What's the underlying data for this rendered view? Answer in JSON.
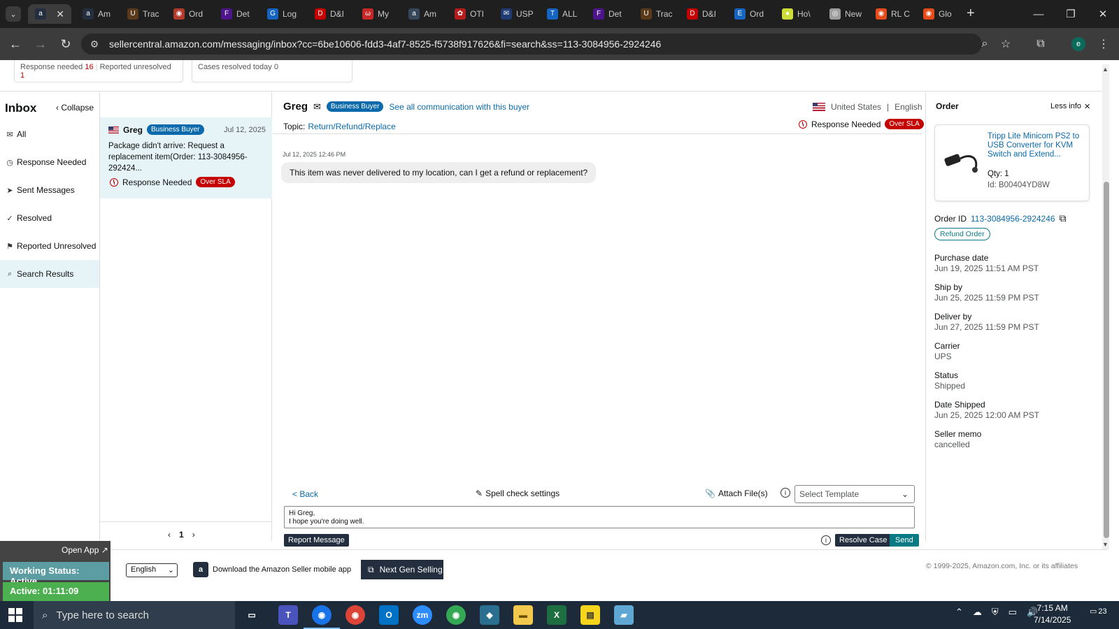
{
  "browser": {
    "tabs": [
      {
        "label": "",
        "color": "#232f3e",
        "glyph": "a"
      },
      {
        "label": "Am",
        "color": "#232f3e",
        "glyph": "a"
      },
      {
        "label": "Trac",
        "color": "#5a3a1a",
        "glyph": "U"
      },
      {
        "label": "Ord",
        "color": "#b03a2e",
        "glyph": "◉"
      },
      {
        "label": "Det",
        "color": "#4d148c",
        "glyph": "F"
      },
      {
        "label": "Log",
        "color": "#1565c0",
        "glyph": "G"
      },
      {
        "label": "D&I",
        "color": "#c40000",
        "glyph": "D"
      },
      {
        "label": "My",
        "color": "#c62828",
        "glyph": "ω"
      },
      {
        "label": "Am",
        "color": "#37475a",
        "glyph": "a"
      },
      {
        "label": "OTI",
        "color": "#b71c1c",
        "glyph": "✿"
      },
      {
        "label": "USP",
        "color": "#1f3b73",
        "glyph": "✉"
      },
      {
        "label": "ALL",
        "color": "#1565c0",
        "glyph": "T"
      },
      {
        "label": "Det",
        "color": "#4d148c",
        "glyph": "F"
      },
      {
        "label": "Trac",
        "color": "#5a3a1a",
        "glyph": "U"
      },
      {
        "label": "D&I",
        "color": "#c40000",
        "glyph": "D"
      },
      {
        "label": "Ord",
        "color": "#1565c0",
        "glyph": "E"
      },
      {
        "label": "Ho\\",
        "color": "#cddc39",
        "glyph": "●"
      },
      {
        "label": "New",
        "color": "#9e9e9e",
        "glyph": "◎"
      },
      {
        "label": "RL C",
        "color": "#e64a19",
        "glyph": "◉"
      },
      {
        "label": "Glo",
        "color": "#e64a19",
        "glyph": "◉"
      }
    ],
    "new_tab": "+",
    "url": "sellercentral.amazon.com/messaging/inbox?cc=6be10606-fdd3-4af7-8525-f5738f917626&fi=search&ss=113-3084956-2924246",
    "profile_initial": "e"
  },
  "stats": {
    "response_needed_label": "Response needed",
    "response_needed_count": "16",
    "reported_unresolved_label": "Reported unresolved",
    "reported_unresolved_count": "1",
    "cases_resolved_label": "Cases resolved today",
    "cases_resolved_count": "0"
  },
  "inbox": {
    "title": "Inbox",
    "collapse_label": "Collapse",
    "nav": [
      {
        "label": "All",
        "icon": "✉"
      },
      {
        "label": "Response Needed",
        "icon": "◷"
      },
      {
        "label": "Sent Messages",
        "icon": "➤"
      },
      {
        "label": "Resolved",
        "icon": "✓"
      },
      {
        "label": "Reported Unresolved",
        "icon": "⚑"
      },
      {
        "label": "Search Results",
        "icon": "⌕"
      }
    ]
  },
  "conversation": {
    "buyer": "Greg",
    "badge": "Business Buyer",
    "date": "Jul 12, 2025",
    "preview": "Package didn't arrive: Request a replacement item(Order: 113-3084956-292424...",
    "status": "Response Needed",
    "sla": "Over SLA"
  },
  "pager": {
    "page": "1",
    "prev": "‹",
    "next": "›"
  },
  "chat": {
    "buyer": "Greg",
    "badge": "Business Buyer",
    "see_all": "See all communication with this buyer",
    "country": "United States",
    "language": "English",
    "topic_label": "Topic:",
    "topic": "Return/Refund/Replace",
    "status": "Response Needed",
    "sla": "Over SLA",
    "message_date": "Jul 12, 2025 12:46 PM",
    "message": "This item was never delivered to my location, can I get a refund or replacement?",
    "back_label": "< Back",
    "spell_check": "Spell check settings",
    "attach": "Attach File(s)",
    "template_placeholder": "Select Template",
    "draft_line1": "Hi Greg,",
    "draft_line2": "I hope you're doing well.",
    "report_btn": "Report Message",
    "resolve_btn": "Resolve Case",
    "send_btn": "Send"
  },
  "order": {
    "title": "Order",
    "less_info": "Less info",
    "product_title": "Tripp Lite Minicom PS2 to USB Converter for KVM Switch and Extend...",
    "qty": "Qty: 1",
    "id": "Id: B00404YD8W",
    "order_id_label": "Order ID",
    "order_id": "113-3084956-2924246",
    "refund_btn": "Refund Order",
    "fields": [
      {
        "label": "Purchase date",
        "value": "Jun 19, 2025 11:51 AM PST"
      },
      {
        "label": "Ship by",
        "value": "Jun 25, 2025 11:59 PM PST"
      },
      {
        "label": "Deliver by",
        "value": "Jun 27, 2025 11:59 PM PST"
      },
      {
        "label": "Carrier",
        "value": "UPS"
      },
      {
        "label": "Status",
        "value": "Shipped"
      },
      {
        "label": "Date Shipped",
        "value": "Jun 25, 2025 12:00 AM PST"
      },
      {
        "label": "Seller memo",
        "value": "cancelled"
      }
    ]
  },
  "footer": {
    "language": "English",
    "download_app": "Download the Amazon Seller mobile app",
    "next_gen": "Next Gen Selling",
    "copyright": "© 1999-2025, Amazon.com, Inc. or its affiliates"
  },
  "widget": {
    "open_app": "Open App ↗",
    "working_status": "Working Status: Active",
    "active_time": "Active: 01:11:09"
  },
  "taskbar": {
    "search_placeholder": "Type here to search",
    "time": "7:15 AM",
    "date": "7/14/2025",
    "notifications": "23"
  }
}
